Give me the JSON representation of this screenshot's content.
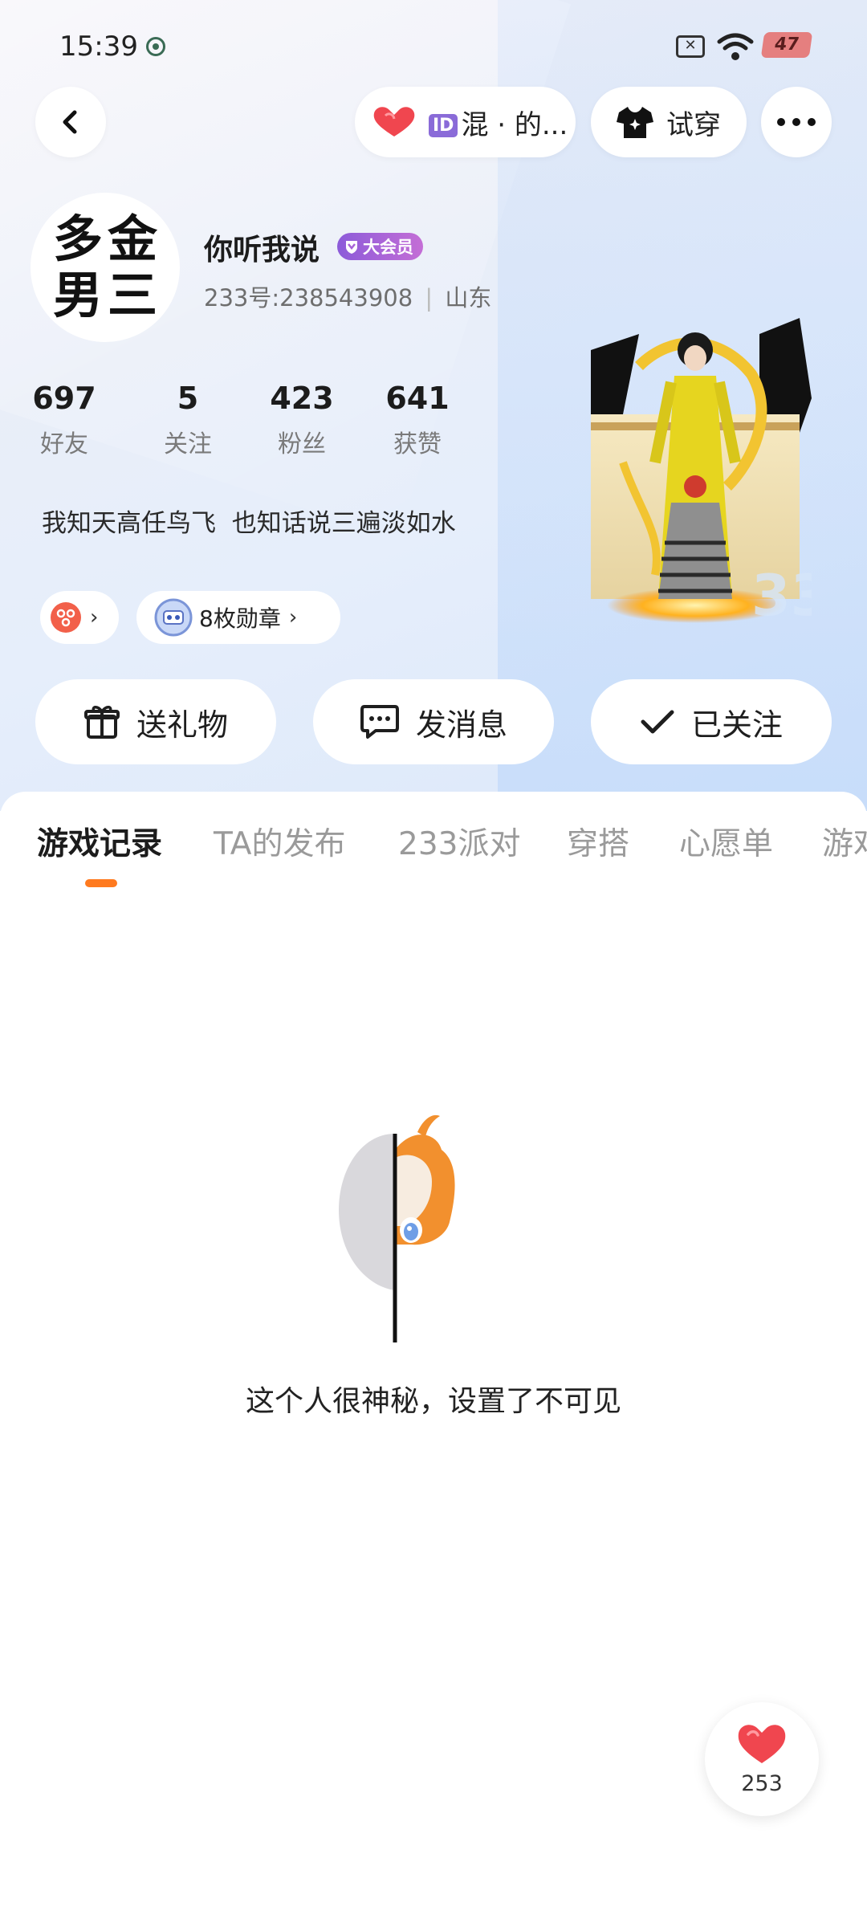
{
  "status_bar": {
    "time": "15:39",
    "battery": "47"
  },
  "top_bar": {
    "id_tag": "ID",
    "group_label": "混 · 的...",
    "try_on_label": "试穿"
  },
  "profile": {
    "avatar_chars": [
      "多",
      "金",
      "男",
      "三"
    ],
    "nickname": "你听我说",
    "vip_label": "大会员",
    "uid_text": "233号:238543908",
    "region": "山东",
    "bio": "我知天高任鸟飞  也知话说三遍淡如水"
  },
  "stats": [
    {
      "value": "697",
      "label": "好友"
    },
    {
      "value": "5",
      "label": "关注"
    },
    {
      "value": "423",
      "label": "粉丝"
    },
    {
      "value": "641",
      "label": "获赞"
    }
  ],
  "chips": {
    "badges_label": "8枚勋章"
  },
  "actions": {
    "gift": "送礼物",
    "message": "发消息",
    "followed": "已关注"
  },
  "tabs": [
    "游戏记录",
    "TA的发布",
    "233派对",
    "穿搭",
    "心愿单",
    "游戏"
  ],
  "empty_state": {
    "message": "这个人很神秘，设置了不可见"
  },
  "like_fab": {
    "count": "253"
  },
  "colors": {
    "accent_orange": "#ff7a1f",
    "heart_red": "#f0464f",
    "vip_purple": "#8c5bd9"
  }
}
